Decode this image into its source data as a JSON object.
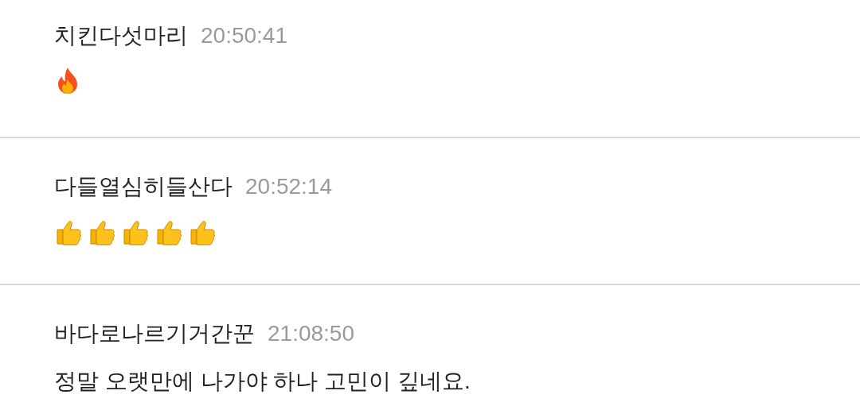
{
  "messages": [
    {
      "author": "치킨다섯마리",
      "time": "20:50:41",
      "kind": "icons",
      "icons": [
        {
          "kind": "fire"
        }
      ]
    },
    {
      "author": "다들열심히들산다",
      "time": "20:52:14",
      "kind": "icons",
      "icons": [
        {
          "kind": "thumbs_up"
        },
        {
          "kind": "thumbs_up"
        },
        {
          "kind": "thumbs_up"
        },
        {
          "kind": "thumbs_up"
        },
        {
          "kind": "thumbs_up"
        }
      ]
    },
    {
      "author": "바다로나르기거간꾼",
      "time": "21:08:50",
      "kind": "text",
      "text": "정말 오랫만에 나가야 하나 고민이 깊네요."
    }
  ]
}
